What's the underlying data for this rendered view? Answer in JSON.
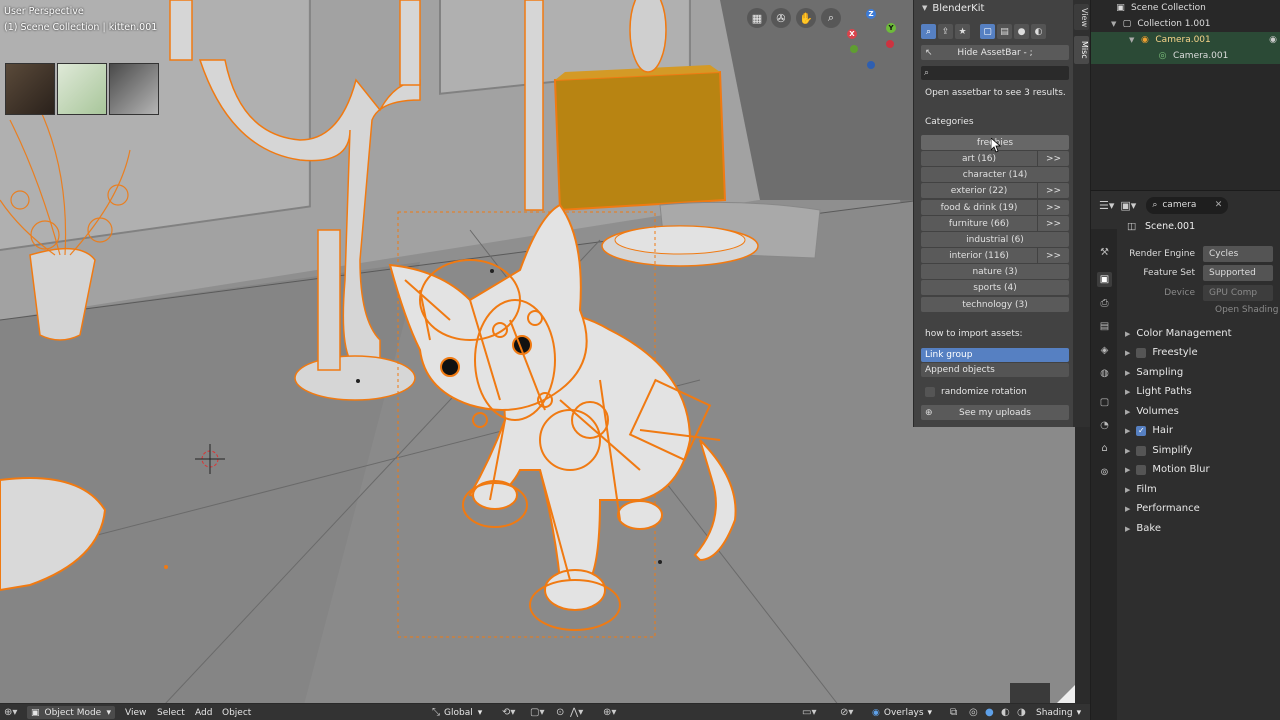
{
  "viewport": {
    "title": "User Perspective",
    "collection_line": "(1) Scene Collection | kitten.001",
    "nav_icons": [
      "grid-view-icon",
      "camera-view-icon",
      "hand-pan-icon",
      "zoom-icon"
    ],
    "gizmo_axes": {
      "z": "Z",
      "y": "Y",
      "x": "X"
    }
  },
  "blenderkit": {
    "title": "BlenderKit",
    "hide_assetbar": "Hide AssetBar - ;",
    "search_value": "",
    "info": "Open assetbar to see 3 results.",
    "categories_label": "Categories",
    "categories": [
      {
        "label": "freebies",
        "more": ""
      },
      {
        "label": "art (16)",
        "more": ">>"
      },
      {
        "label": "character (14)",
        "more": ""
      },
      {
        "label": "exterior (22)",
        "more": ">>"
      },
      {
        "label": "food & drink (19)",
        "more": ">>"
      },
      {
        "label": "furniture (66)",
        "more": ">>"
      },
      {
        "label": "industrial (6)",
        "more": ""
      },
      {
        "label": "interior (116)",
        "more": ">>"
      },
      {
        "label": "nature (3)",
        "more": ""
      },
      {
        "label": "sports (4)",
        "more": ""
      },
      {
        "label": "technology (3)",
        "more": ""
      }
    ],
    "import_label": "how to import assets:",
    "link_group": "Link group",
    "append_objects": "Append objects",
    "randomize_rotation": "randomize rotation",
    "see_uploads": "See my uploads"
  },
  "side_tabs": {
    "view": "View",
    "misc": "Misc"
  },
  "outliner": {
    "root": "Scene Collection",
    "collection": "Collection 1.001",
    "camera_object": "Camera.001",
    "camera_data": "Camera.001"
  },
  "properties": {
    "search_value": "camera",
    "scene": "Scene.001",
    "render_engine_label": "Render Engine",
    "render_engine_value": "Cycles",
    "feature_set_label": "Feature Set",
    "feature_set_value": "Supported",
    "device_label": "Device",
    "device_value": "GPU Comp",
    "open_shading": "Open Shading La",
    "sections": [
      {
        "label": "Color Management",
        "checkbox": "none"
      },
      {
        "label": "Freestyle",
        "checkbox": "off"
      },
      {
        "label": "Sampling",
        "checkbox": "none"
      },
      {
        "label": "Light Paths",
        "checkbox": "none"
      },
      {
        "label": "Volumes",
        "checkbox": "none"
      },
      {
        "label": "Hair",
        "checkbox": "on"
      },
      {
        "label": "Simplify",
        "checkbox": "off"
      },
      {
        "label": "Motion Blur",
        "checkbox": "off"
      },
      {
        "label": "Film",
        "checkbox": "none"
      },
      {
        "label": "Performance",
        "checkbox": "none"
      },
      {
        "label": "Bake",
        "checkbox": "none"
      }
    ]
  },
  "footer": {
    "mode": "Object Mode",
    "view": "View",
    "select": "Select",
    "add": "Add",
    "object": "Object",
    "orientation": "Global",
    "overlays": "Overlays",
    "shading": "Shading"
  },
  "colors": {
    "accent": "#5680c2",
    "selection_orange": "#f07a12",
    "viewport_bg": "#8f8f8f"
  }
}
